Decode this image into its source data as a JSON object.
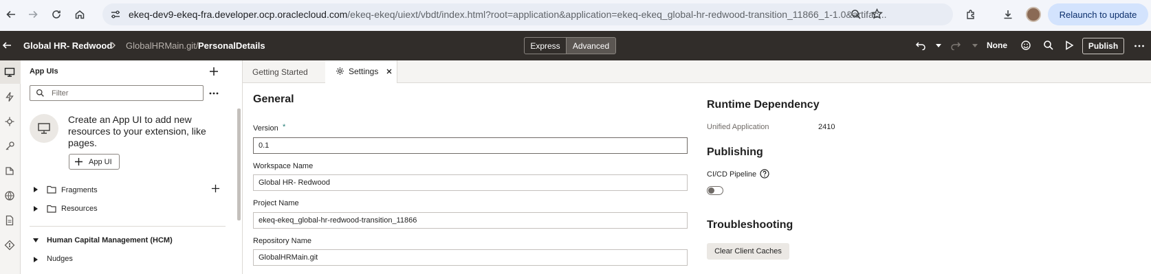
{
  "browser": {
    "url_domain": "ekeq-dev9-ekeq-fra.developer.ocp.oraclecloud.com",
    "url_path": "/ekeq-ekeq/uiext/vbdt/index.html?root=application&application=ekeq-ekeq_global-hr-redwood-transition_11866_1-1.0&artifac...",
    "relaunch_label": "Relaunch to update"
  },
  "header": {
    "app_name": "Global HR- Redwood",
    "repo_prefix": "GlobalHRMain.git/",
    "page_name": "PersonalDetails",
    "mode_express": "Express",
    "mode_advanced": "Advanced",
    "none_label": "None",
    "publish_label": "Publish"
  },
  "navigator": {
    "title": "App UIs",
    "filter_placeholder": "Filter",
    "empty_message": "Create an App UI to add new resources to your extension, like pages.",
    "add_app_ui_label": "App UI",
    "tree": {
      "fragments": "Fragments",
      "resources": "Resources",
      "hcm_group": "Human Capital Management (HCM)",
      "nudges": "Nudges"
    }
  },
  "tabs": {
    "getting_started": "Getting Started",
    "settings": "Settings"
  },
  "general": {
    "heading": "General",
    "version_label": "Version",
    "required_mark": "*",
    "version_value": "0.1",
    "workspace_label": "Workspace Name",
    "workspace_value": "Global HR- Redwood",
    "project_label": "Project Name",
    "project_value": "ekeq-ekeq_global-hr-redwood-transition_11866",
    "repo_label": "Repository Name",
    "repo_value": "GlobalHRMain.git"
  },
  "runtime": {
    "heading": "Runtime Dependency",
    "unified_label": "Unified Application",
    "unified_value": "2410"
  },
  "publishing": {
    "heading": "Publishing",
    "cicd_label": "CI/CD Pipeline",
    "cicd_enabled": false
  },
  "troubleshooting": {
    "heading": "Troubleshooting",
    "clear_caches_label": "Clear Client Caches"
  }
}
